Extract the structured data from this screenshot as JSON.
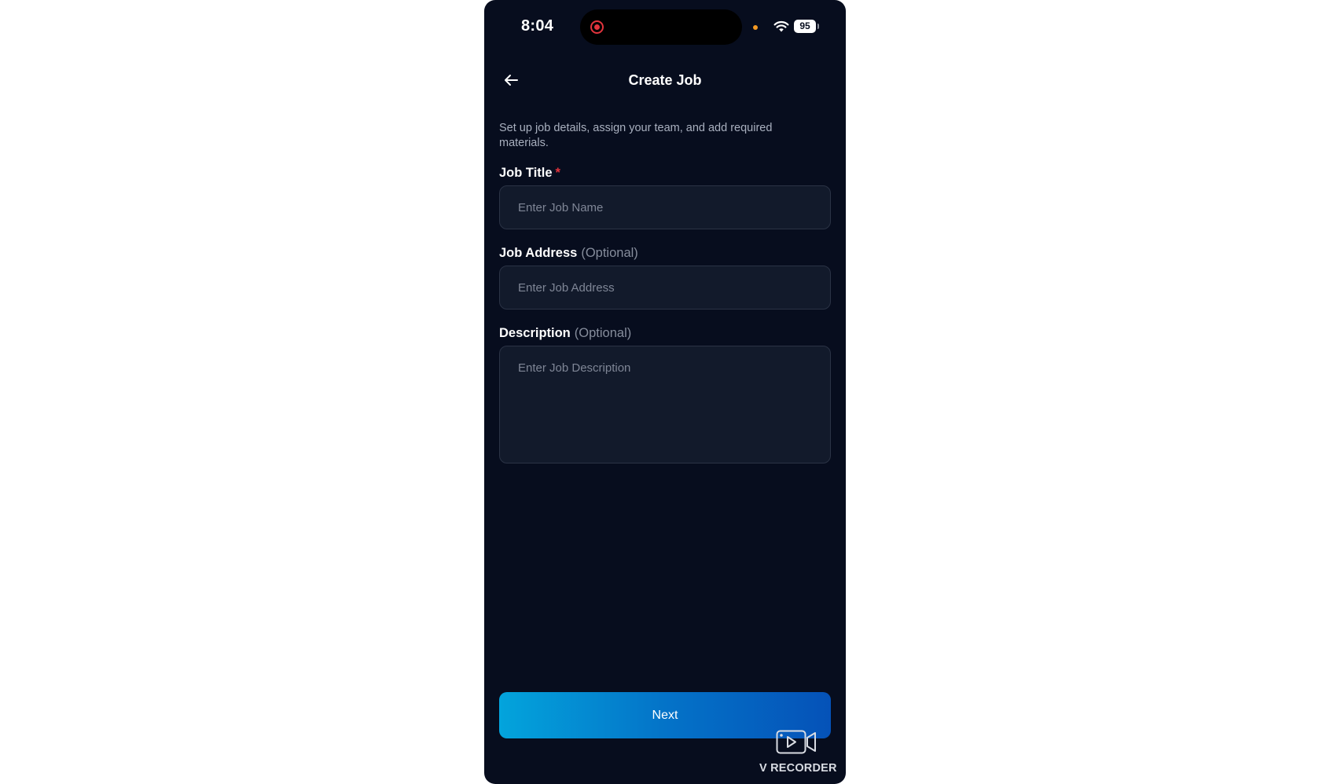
{
  "status_bar": {
    "time": "8:04",
    "battery": "95"
  },
  "header": {
    "title": "Create Job"
  },
  "subtitle": "Set up job details, assign your team, and add required materials.",
  "form": {
    "job_title": {
      "label": "Job Title",
      "required_mark": "*",
      "placeholder": "Enter Job Name"
    },
    "job_address": {
      "label": "Job Address",
      "optional": "(Optional)",
      "placeholder": "Enter Job Address"
    },
    "description": {
      "label": "Description",
      "optional": "(Optional)",
      "placeholder": "Enter Job Description"
    }
  },
  "next_label": "Next",
  "watermark": "V RECORDER",
  "colors": {
    "background": "#070d1e",
    "input_bg": "#121a2b",
    "required": "#e3343d",
    "button_gradient_start": "#03a4dc",
    "button_gradient_end": "#0552b8"
  }
}
